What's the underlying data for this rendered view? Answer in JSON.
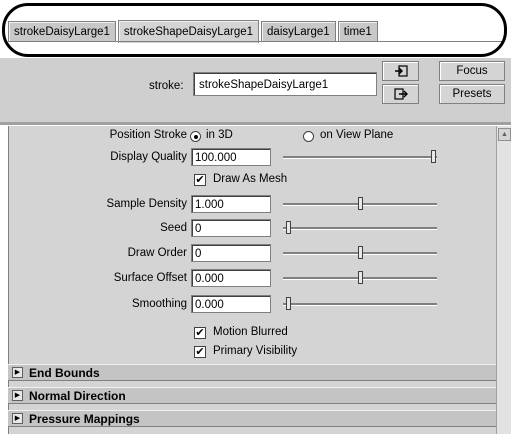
{
  "tabs": [
    {
      "label": "strokeDaisyLarge1"
    },
    {
      "label": "strokeShapeDaisyLarge1"
    },
    {
      "label": "daisyLarge1"
    },
    {
      "label": "time1"
    }
  ],
  "header": {
    "stroke_label": "stroke:",
    "stroke_value": "strokeShapeDaisyLarge1",
    "focus_label": "Focus",
    "presets_label": "Presets",
    "icons": [
      "load-attributes-icon",
      "go-to-output-icon"
    ]
  },
  "attributes": {
    "position_stroke": {
      "label": "Position Stroke",
      "option_3d": "in 3D",
      "option_view": "on View Plane",
      "selected": "in 3D"
    },
    "display_quality": {
      "label": "Display Quality",
      "value": "100.000",
      "slider": 1.0
    },
    "draw_as_mesh": {
      "label": "Draw As Mesh",
      "checked": true
    },
    "sample_density": {
      "label": "Sample Density",
      "value": "1.000",
      "slider": 0.5
    },
    "seed": {
      "label": "Seed",
      "value": "0",
      "slider": 0.0
    },
    "draw_order": {
      "label": "Draw Order",
      "value": "0",
      "slider": 0.5
    },
    "surface_offset": {
      "label": "Surface Offset",
      "value": "0.000",
      "slider": 0.5
    },
    "smoothing": {
      "label": "Smoothing",
      "value": "0.000",
      "slider": 0.0
    },
    "motion_blurred": {
      "label": "Motion Blurred",
      "checked": true
    },
    "primary_visibility": {
      "label": "Primary Visibility",
      "checked": true
    }
  },
  "sections": [
    {
      "title": "End Bounds"
    },
    {
      "title": "Normal Direction"
    },
    {
      "title": "Pressure Mappings"
    }
  ],
  "colors": {
    "panel_bg": "#d4d4d4",
    "highlight_ring": "#000000"
  }
}
